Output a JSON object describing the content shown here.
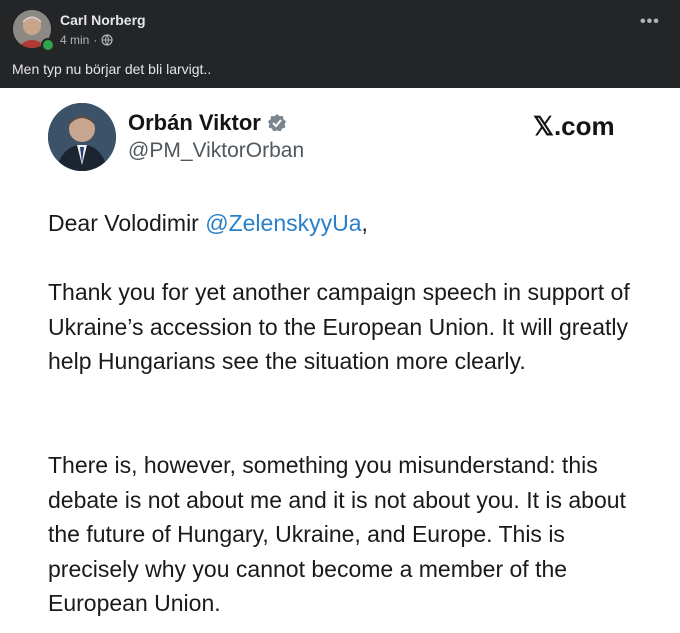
{
  "post": {
    "author": "Carl Norberg",
    "time": "4 min",
    "separator": "·",
    "text": "Men typ nu börjar det bli larvigt..",
    "more_icon": "•••"
  },
  "tweet": {
    "name": "Orbán Viktor",
    "handle": "@PM_ViktorOrban",
    "brand": "𝕏.com",
    "greeting_prefix": "Dear Volodimir ",
    "greeting_mention": "@ZelenskyyUa",
    "greeting_suffix": ",",
    "paragraph1": "Thank you for yet another campaign speech in support of Ukraine’s accession to the European Union. It will greatly help Hungarians see the situation more clearly.",
    "paragraph2": "There is, however, something you misunderstand: this debate is not about me and it is not about you. It is about the future of Hungary, Ukraine, and Europe. This is precisely why you cannot become a member of the European Union."
  },
  "colors": {
    "header_bg": "#242526",
    "online": "#31a24c",
    "mention": "#2980c9",
    "verified": "#7a8590"
  },
  "icons": [
    "globe-icon",
    "more-options-icon",
    "verified-badge-icon",
    "online-status-icon"
  ]
}
